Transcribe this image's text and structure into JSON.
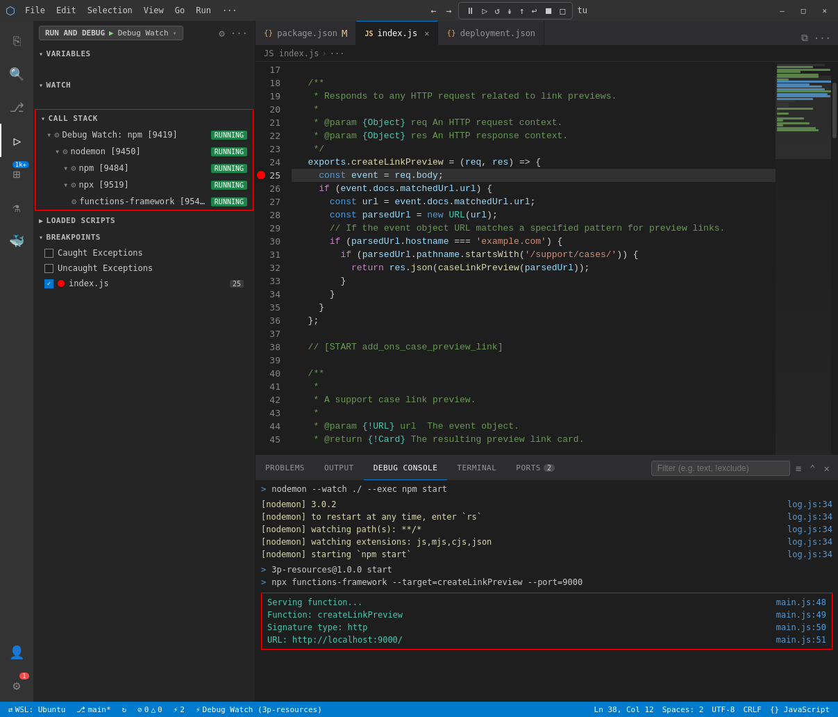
{
  "titlebar": {
    "icon": "⬡",
    "menus": [
      "File",
      "Edit",
      "Selection",
      "View",
      "Go",
      "Run",
      "···"
    ],
    "nav_back": "←",
    "nav_forward": "→",
    "debug_controls": [
      "⏸",
      "▷",
      "↺",
      "↡",
      "↑",
      "↩",
      "⏹",
      "□"
    ],
    "profile": "tu",
    "window_min": "—",
    "window_max": "□",
    "window_close": "✕"
  },
  "sidebar": {
    "run_and_debug_label": "RUN AND DEBUG",
    "debug_watch_label": "Debug Watch",
    "sections": {
      "variables": "VARIABLES",
      "watch": "WATCH",
      "callstack": "CALL STACK",
      "loaded_scripts": "LOADED SCRIPTS",
      "breakpoints": "BREAKPOINTS"
    },
    "callstack_items": [
      {
        "name": "Debug Watch: npm [9419]",
        "status": "RUNNING",
        "indent": 1
      },
      {
        "name": "nodemon [9450]",
        "status": "RUNNING",
        "indent": 2
      },
      {
        "name": "npm [9484]",
        "status": "RUNNING",
        "indent": 3
      },
      {
        "name": "npx [9519]",
        "status": "RUNNING",
        "indent": 3
      },
      {
        "name": "functions-framework [954…",
        "status": "RUNNING",
        "indent": 4
      }
    ],
    "breakpoints": [
      {
        "label": "Caught Exceptions",
        "checked": false,
        "type": "checkbox"
      },
      {
        "label": "Uncaught Exceptions",
        "checked": false,
        "type": "checkbox"
      },
      {
        "label": "index.js",
        "checked": true,
        "type": "dot",
        "count": "25"
      }
    ]
  },
  "tabs": [
    {
      "label": "package.json",
      "icon": "{}",
      "modified": true,
      "active": false
    },
    {
      "label": "index.js",
      "icon": "JS",
      "active": true,
      "close": true
    },
    {
      "label": "deployment.json",
      "icon": "{}",
      "active": false
    }
  ],
  "breadcrumb": {
    "parts": [
      "JS index.js",
      "···"
    ]
  },
  "editor": {
    "lines": [
      {
        "num": 17,
        "content": ""
      },
      {
        "num": 18,
        "content": "  /**"
      },
      {
        "num": 19,
        "content": "   * Responds to any HTTP request related to link previews."
      },
      {
        "num": 20,
        "content": "   *"
      },
      {
        "num": 21,
        "content": "   * @param {Object} req An HTTP request context."
      },
      {
        "num": 22,
        "content": "   * @param {Object} res An HTTP response context."
      },
      {
        "num": 23,
        "content": "   */"
      },
      {
        "num": 24,
        "content": "  exports.createLinkPreview = (req, res) => {"
      },
      {
        "num": 25,
        "content": "    const event = req.body;",
        "breakpoint": true
      },
      {
        "num": 26,
        "content": "    if (event.docs.matchedUrl.url) {"
      },
      {
        "num": 27,
        "content": "      const url = event.docs.matchedUrl.url;"
      },
      {
        "num": 28,
        "content": "      const parsedUrl = new URL(url);"
      },
      {
        "num": 29,
        "content": "      // If the event object URL matches a specified pattern for preview links."
      },
      {
        "num": 30,
        "content": "      if (parsedUrl.hostname === 'example.com') {"
      },
      {
        "num": 31,
        "content": "        if (parsedUrl.pathname.startsWith('/support/cases/')) {"
      },
      {
        "num": 32,
        "content": "          return res.json(caseLinkPreview(parsedUrl));"
      },
      {
        "num": 33,
        "content": "        }"
      },
      {
        "num": 34,
        "content": "      }"
      },
      {
        "num": 35,
        "content": "    }"
      },
      {
        "num": 36,
        "content": "  };"
      },
      {
        "num": 37,
        "content": ""
      },
      {
        "num": 38,
        "content": "  // [START add_ons_case_preview_link]"
      },
      {
        "num": 39,
        "content": ""
      },
      {
        "num": 40,
        "content": "  /**"
      },
      {
        "num": 41,
        "content": "   *"
      },
      {
        "num": 42,
        "content": "   * A support case link preview."
      },
      {
        "num": 43,
        "content": "   *"
      },
      {
        "num": 44,
        "content": "   * @param {!URL} url  The event object."
      },
      {
        "num": 45,
        "content": "   * @return {!Card} The resulting preview link card."
      }
    ]
  },
  "panel": {
    "tabs": [
      "PROBLEMS",
      "OUTPUT",
      "DEBUG CONSOLE",
      "TERMINAL",
      "PORTS"
    ],
    "ports_badge": "2",
    "active_tab": "DEBUG CONSOLE",
    "filter_placeholder": "Filter (e.g. text, !exclude)",
    "console_lines": [
      {
        "type": "prompt",
        "text": "nodemon --watch ./ --exec npm start"
      },
      {
        "type": "text",
        "text": ""
      },
      {
        "type": "yellow",
        "text": "[nodemon] 3.0.2",
        "ref": "log.js:34"
      },
      {
        "type": "yellow",
        "text": "[nodemon] to restart at any time, enter `rs`",
        "ref": "log.js:34"
      },
      {
        "type": "yellow",
        "text": "[nodemon] watching path(s): **/*",
        "ref": "log.js:34"
      },
      {
        "type": "yellow",
        "text": "[nodemon] watching extensions: js,mjs,cjs,json",
        "ref": "log.js:34"
      },
      {
        "type": "yellow",
        "text": "[nodemon] starting `npm start`",
        "ref": "log.js:34"
      },
      {
        "type": "text",
        "text": ""
      },
      {
        "type": "prompt",
        "text": "3p-resources@1.0.0 start"
      },
      {
        "type": "prompt",
        "text": "npx functions-framework --target=createLinkPreview --port=9000"
      },
      {
        "type": "text",
        "text": ""
      },
      {
        "type": "highlighted",
        "lines": [
          {
            "text": "Serving function...",
            "ref": "main.js:48"
          },
          {
            "text": "Function: createLinkPreview",
            "ref": "main.js:49"
          },
          {
            "text": "Signature type: http",
            "ref": "main.js:50"
          },
          {
            "text": "URL: http://localhost:9000/",
            "ref": "main.js:51"
          }
        ]
      }
    ]
  },
  "statusbar": {
    "left": [
      {
        "icon": "⎇",
        "text": "WSL: Ubuntu"
      },
      {
        "icon": "⎇",
        "text": "main*"
      },
      {
        "icon": "↻",
        "text": ""
      },
      {
        "icon": "⊘",
        "text": "0 △ 0"
      },
      {
        "icon": "",
        "text": "⚡ 2"
      },
      {
        "icon": "",
        "text": "⚡ Debug Watch (3p-resources)"
      }
    ],
    "right": [
      {
        "text": "Ln 38, Col 12"
      },
      {
        "text": "Spaces: 2"
      },
      {
        "text": "UTF-8"
      },
      {
        "text": "CRLF"
      },
      {
        "text": "{} JavaScript"
      }
    ]
  },
  "activity_bar": {
    "items": [
      {
        "icon": "⟩",
        "label": "explorer-icon",
        "active": false
      },
      {
        "icon": "🔍",
        "label": "search-icon",
        "active": false
      },
      {
        "icon": "⎇",
        "label": "source-control-icon",
        "active": false
      },
      {
        "icon": "▷",
        "label": "run-debug-icon",
        "active": true
      },
      {
        "icon": "⚙",
        "label": "extensions-icon",
        "active": false,
        "badge": "1k+"
      },
      {
        "icon": "☰",
        "label": "test-icon",
        "active": false
      },
      {
        "icon": "🐳",
        "label": "docker-icon",
        "active": false
      }
    ],
    "bottom": [
      {
        "icon": "👤",
        "label": "account-icon"
      },
      {
        "icon": "⚙",
        "label": "settings-icon",
        "badge": "1",
        "badge_red": true
      }
    ]
  }
}
